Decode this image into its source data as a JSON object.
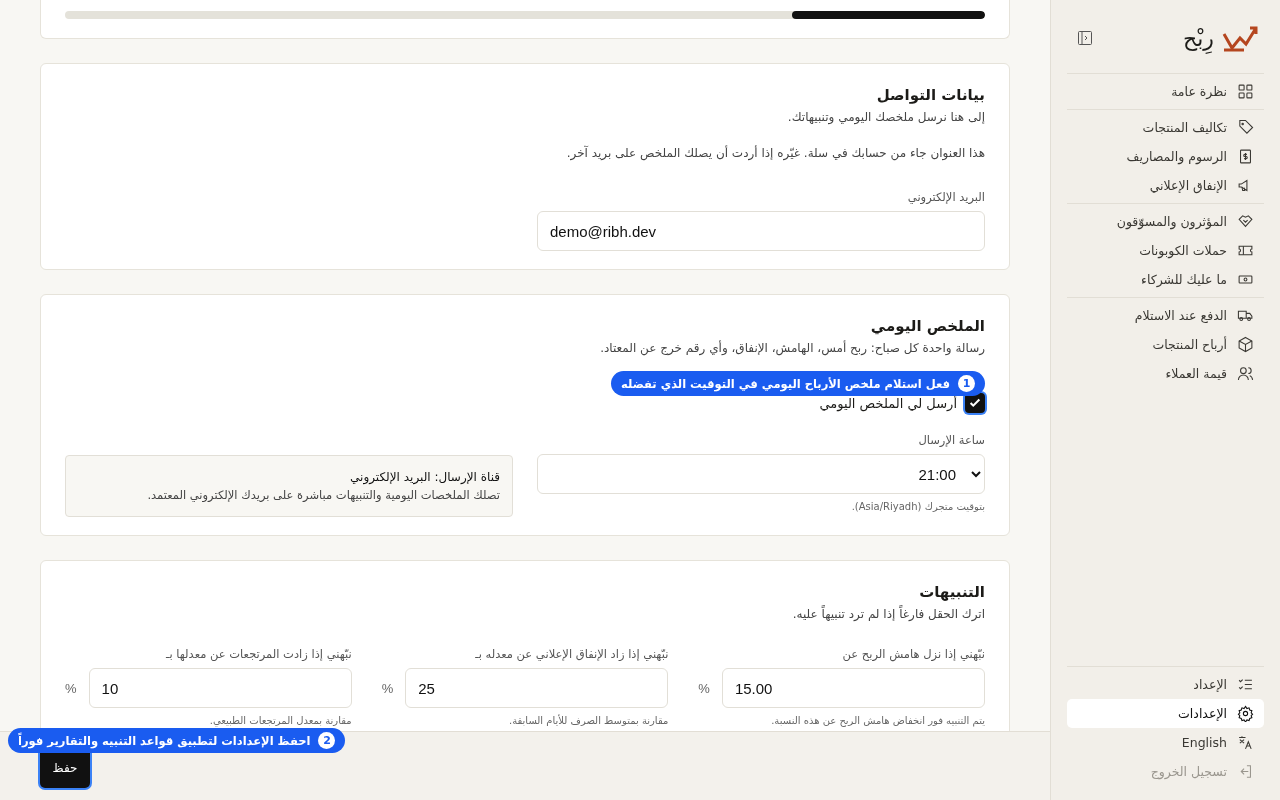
{
  "usage_card": {
    "level": 0.21
  },
  "contact": {
    "title": "بيانات التواصل",
    "subtitle": "إلى هنا نرسل ملخصك اليومي وتنبيهاتك.",
    "note": "هذا العنوان جاء من حسابك في سلة. غيّره إذا أردت أن يصلك الملخص على بريد آخر.",
    "email_label": "البريد الإلكتروني",
    "email_value": "demo@ribh.dev"
  },
  "daily": {
    "title": "الملخص اليومي",
    "subtitle": "رسالة واحدة كل صباح: ربح أمس، الهامش، الإنفاق، وأي رقم خرج عن المعتاد.",
    "checkbox": {
      "label": "أرسل لي الملخص اليومي",
      "checked": true
    },
    "time_label": "ساعة الإرسال",
    "time_value": "21:00",
    "time_hint": "بتوقيت متجرك (Asia/Riyadh).",
    "channel_title": "قناة الإرسال: البريد الإلكتروني",
    "channel_text": "تصلك الملخصات اليومية والتنبيهات مباشرة على بريدك الإلكتروني المعتمد."
  },
  "alerts": {
    "title": "التنبيهات",
    "subtitle": "اترك الحقل فارغاً إذا لم ترد تنبيهاً عليه.",
    "fields": [
      {
        "label": "نبّهني إذا نزل هامش الربح عن",
        "value": "15.00",
        "unit": "%",
        "hint": "يتم التنبيه فور انخفاض هامش الربح عن هذه النسبة."
      },
      {
        "label": "نبّهني إذا زاد الإنفاق الإعلاني عن معدله بـ",
        "value": "25",
        "unit": "%",
        "hint": "مقارنة بمتوسط الصرف للأيام السابقة."
      },
      {
        "label": "نبّهني إذا زادت المرتجعات عن معدلها بـ",
        "value": "10",
        "unit": "%",
        "hint": "مقارنة بمعدل المرتجعات الطبيعي."
      }
    ]
  },
  "footer": {
    "save_button": "حفظ"
  },
  "tour_tips": [
    {
      "step": "1",
      "text": "فعل استلام ملخص الأرباح اليومي في التوقيت الذي تفضله"
    },
    {
      "step": "2",
      "text": "احفظ الإعدادات لتطبيق قواعد التنبيه والتقارير فوراً"
    }
  ],
  "sidebar": {
    "logo_text": "رِبْح",
    "groups": [
      [
        {
          "label": "نظرة عامة",
          "selected": false
        }
      ],
      [
        {
          "label": "تكاليف المنتجات",
          "selected": false
        },
        {
          "label": "الرسوم والمصاريف",
          "selected": false
        },
        {
          "label": "الإنفاق الإعلاني",
          "selected": false
        }
      ],
      [
        {
          "label": "المؤثرون والمسوّقون",
          "selected": false
        },
        {
          "label": "حملات الكوبونات",
          "selected": false
        },
        {
          "label": "ما عليك للشركاء",
          "selected": false
        }
      ],
      [
        {
          "label": "الدفع عند الاستلام",
          "selected": false
        },
        {
          "label": "أرباح المنتجات",
          "selected": false
        },
        {
          "label": "قيمة العملاء",
          "selected": false
        }
      ]
    ],
    "bottom": [
      {
        "label": "الإعداد",
        "selected": false
      },
      {
        "label": "الإعدادات",
        "selected": true
      },
      {
        "label": "English",
        "selected": false
      },
      {
        "label": "تسجيل الخروج",
        "selected": false
      }
    ]
  }
}
